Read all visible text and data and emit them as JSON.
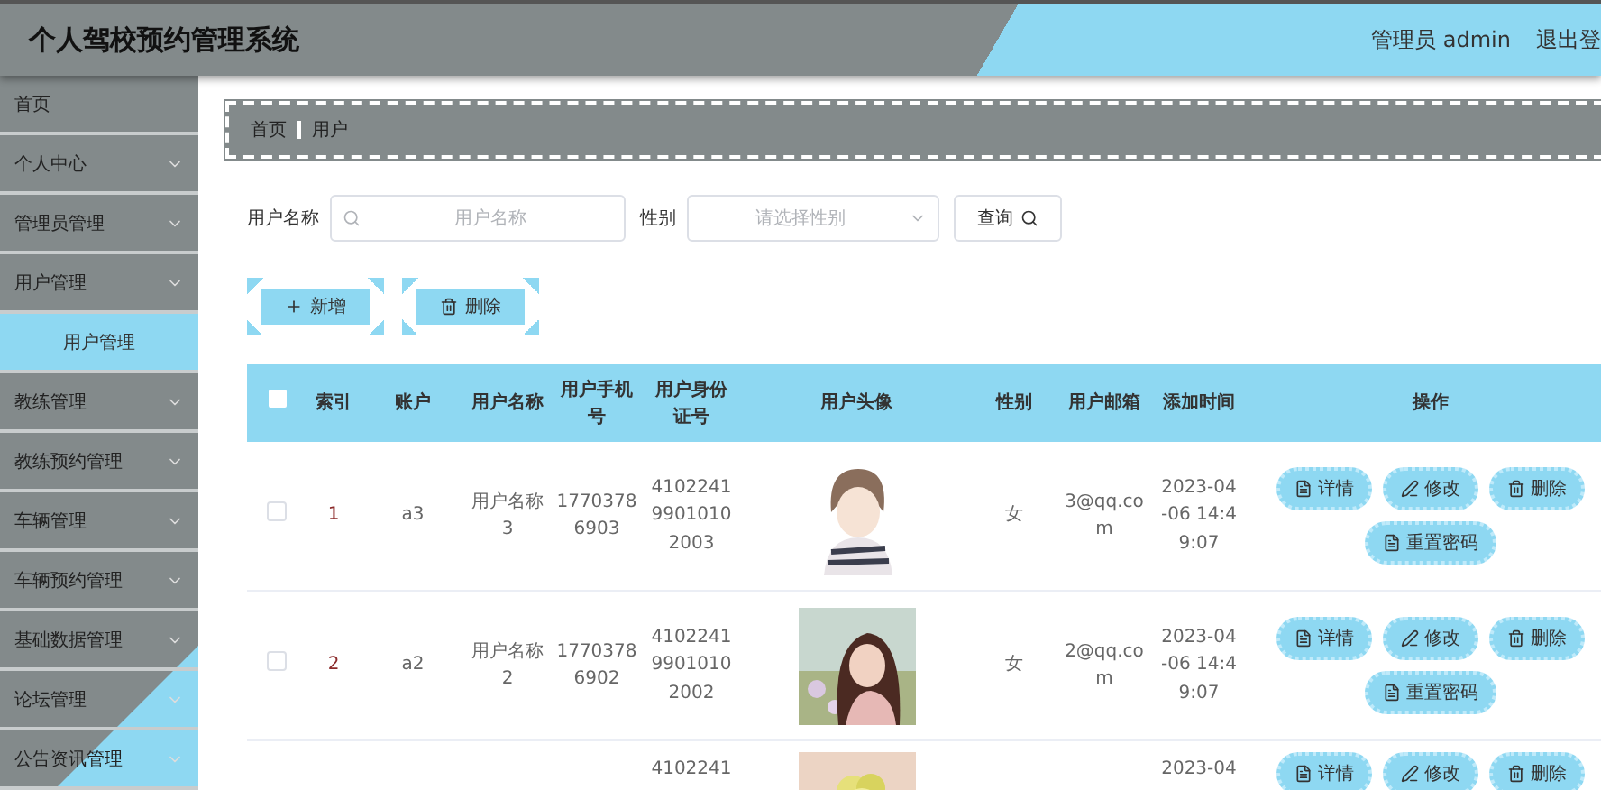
{
  "header": {
    "title": "个人驾校预约管理系统",
    "user": "管理员 admin",
    "logout": "退出登"
  },
  "sidebar": {
    "items": [
      {
        "label": "首页",
        "kind": "link",
        "selected": false
      },
      {
        "label": "个人中心",
        "kind": "menu",
        "selected": false
      },
      {
        "label": "管理员管理",
        "kind": "menu",
        "selected": false
      },
      {
        "label": "用户管理",
        "kind": "menu",
        "selected": false,
        "children": [
          {
            "label": "用户管理",
            "selected": true
          }
        ]
      },
      {
        "label": "教练管理",
        "kind": "menu",
        "selected": false
      },
      {
        "label": "教练预约管理",
        "kind": "menu",
        "selected": false
      },
      {
        "label": "车辆管理",
        "kind": "menu",
        "selected": false
      },
      {
        "label": "车辆预约管理",
        "kind": "menu",
        "selected": false
      },
      {
        "label": "基础数据管理",
        "kind": "menu",
        "selected": false
      },
      {
        "label": "论坛管理",
        "kind": "menu",
        "selected": false
      },
      {
        "label": "公告资讯管理",
        "kind": "menu",
        "selected": false
      }
    ]
  },
  "breadcrumb": [
    "首页",
    "用户"
  ],
  "search": {
    "name_label": "用户名称",
    "name_placeholder": "用户名称",
    "gender_label": "性别",
    "gender_placeholder": "请选择性别",
    "query_button": "查询"
  },
  "actions": {
    "add": "新增",
    "delete": "删除"
  },
  "table": {
    "select_all": {
      "checked": false
    },
    "columns": [
      "索引",
      "账户",
      "用户名称",
      "用户手机号",
      "用户身份证号",
      "用户头像",
      "性别",
      "用户邮箱",
      "添加时间",
      "操作"
    ],
    "rows": [
      {
        "checked": false,
        "index": "1",
        "account": "a3",
        "name": "用户名称3",
        "phone": "17703786903",
        "id_card": "410224199010102003",
        "avatar": {
          "kind": "picture"
        },
        "gender": "女",
        "email": "3@qq.com",
        "time": "2023-04-06 14:49:07",
        "buttons": [
          "详情",
          "修改",
          "删除",
          "重置密码"
        ]
      },
      {
        "checked": false,
        "index": "2",
        "account": "a2",
        "name": "用户名称2",
        "phone": "17703786902",
        "id_card": "410224199010102002",
        "avatar": {
          "kind": "picture"
        },
        "gender": "女",
        "email": "2@qq.com",
        "time": "2023-04-06 14:49:07",
        "buttons": [
          "详情",
          "修改",
          "删除",
          "重置密码"
        ]
      },
      {
        "id_card": "4102241",
        "avatar": {
          "kind": "picture"
        },
        "time": "2023-04",
        "buttons": [
          "详情",
          "修改",
          "删除"
        ]
      }
    ]
  }
}
